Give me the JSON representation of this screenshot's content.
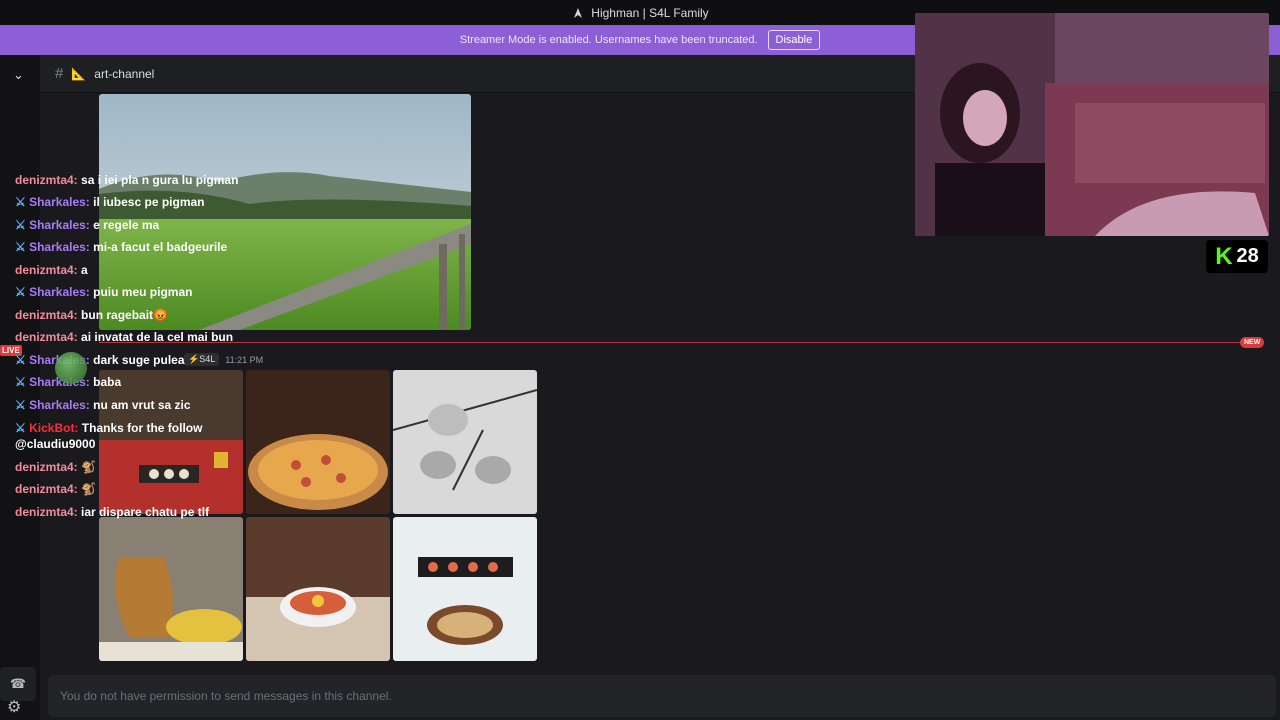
{
  "titlebar": {
    "title": "Highman | S4L Family",
    "logo_icon": "s4l-logo-icon"
  },
  "streamer_bar": {
    "message": "Streamer Mode is enabled. Usernames have been truncated.",
    "button_label": "Disable"
  },
  "sidebar": {
    "live_badge": "LIVE"
  },
  "channel": {
    "name": "art-channel"
  },
  "divider": {
    "new_label": "NEW"
  },
  "post_meta": {
    "tag": "⚡S4L",
    "time": "11:21 PM"
  },
  "composer": {
    "placeholder": "You do not have permission to send messages in this channel."
  },
  "kick": {
    "viewers": "28"
  },
  "chat": {
    "messages": [
      {
        "user": "denizmta4:",
        "text": "sa i iei pla n gura lu pigman",
        "badge": false,
        "style": "pink"
      },
      {
        "user": "Sharkales:",
        "text": "il iubesc pe pigman",
        "badge": true,
        "style": "purple"
      },
      {
        "user": "Sharkales:",
        "text": "e regele ma",
        "badge": true,
        "style": "purple"
      },
      {
        "user": "Sharkales:",
        "text": "mi-a facut el badgeurile",
        "badge": true,
        "style": "purple"
      },
      {
        "user": "denizmta4:",
        "text": "a",
        "badge": false,
        "style": "pink"
      },
      {
        "user": "Sharkales:",
        "text": "puiu meu pigman",
        "badge": true,
        "style": "purple"
      },
      {
        "user": "denizmta4:",
        "text": "bun ragebait😡",
        "badge": false,
        "style": "pink"
      },
      {
        "user": "denizmta4:",
        "text": "ai invatat de la cel mai bun",
        "badge": false,
        "style": "pink"
      },
      {
        "user": "Sharkales:",
        "text": "dark suge pulea",
        "badge": true,
        "style": "purple"
      },
      {
        "user": "Sharkales:",
        "text": "baba",
        "badge": true,
        "style": "purple"
      },
      {
        "user": "Sharkales:",
        "text": "nu am vrut sa zic",
        "badge": true,
        "style": "purple"
      },
      {
        "user": "KickBot:",
        "text": "Thanks for the follow",
        "badge": true,
        "style": "red"
      },
      {
        "user": "",
        "text": "@claudiu9000",
        "badge": false,
        "style": "pink"
      },
      {
        "user": "denizmta4:",
        "text": "🐒",
        "badge": false,
        "style": "pink"
      },
      {
        "user": "denizmta4:",
        "text": "🐒",
        "badge": false,
        "style": "pink"
      },
      {
        "user": "denizmta4:",
        "text": "iar dispare chatu pe tlf",
        "badge": false,
        "style": "pink"
      }
    ]
  }
}
